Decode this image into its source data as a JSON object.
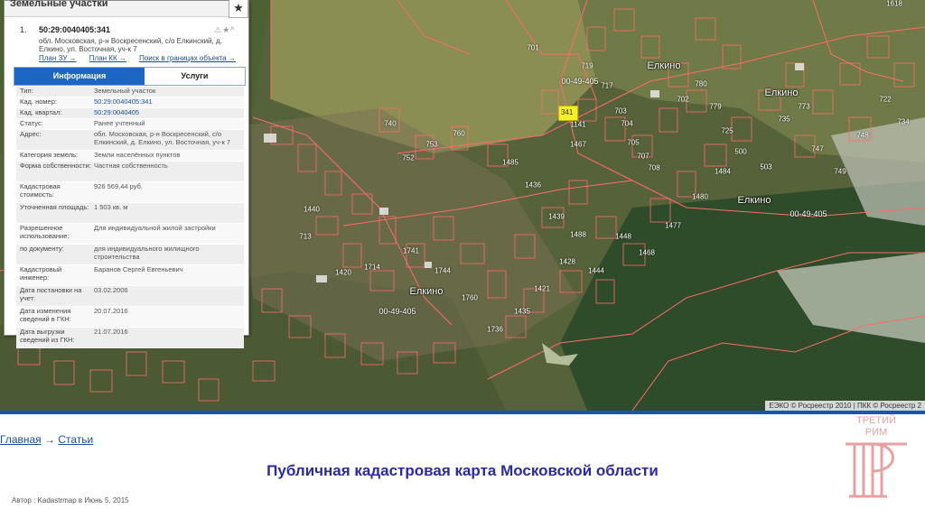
{
  "panel": {
    "title": "Земельные участки",
    "star_icon": "★",
    "result": {
      "index": "1.",
      "cad_number": "50:29:0040405:341",
      "address": "обл. Московская, р-н Воскресенский, с/о Елкинский, д. Елкино, ул. Восточная, уч-к 7",
      "icons": "⚠★^",
      "links": [
        "План ЗУ →",
        "План КК →",
        "Поиск в границах объекта →"
      ]
    },
    "tabs": [
      "Информация",
      "Услуги"
    ],
    "rows": [
      {
        "k": "Тип:",
        "v": "Земельный участок"
      },
      {
        "k": "Кад. номер:",
        "v": "50:29:0040405:341"
      },
      {
        "k": "Кад. квартал:",
        "v": "50:29:0040405"
      },
      {
        "k": "Статус:",
        "v": "Ранее учтенный"
      },
      {
        "k": "Адрес:",
        "v": "обл. Московская, р-н Воскресенский, с/о Елкинский, д. Елкино, ул. Восточная, уч-к 7"
      },
      {
        "k": "Категория земель:",
        "v": "Земли населённых пунктов"
      },
      {
        "k": "Форма собственности:",
        "v": "Частная собственность"
      },
      {
        "k": "Кадастровая стоимость:",
        "v": "926 569,44 руб."
      },
      {
        "k": "Уточненная площадь:",
        "v": "1 503 кв. м"
      },
      {
        "k": "Разрешенное использование:",
        "v": "Для индивидуальной жилой застройки"
      },
      {
        "k": "по документу:",
        "v": "для индивидуального жилищного строительства"
      },
      {
        "k": "Кадастровый инженер:",
        "v": "Баранов Сергей Евгеньевич"
      },
      {
        "k": "Дата постановки на учет:",
        "v": "03.02.2006"
      },
      {
        "k": "Дата изменения сведений в ГКН:",
        "v": "20.07.2016"
      },
      {
        "k": "Дата выгрузки сведений из ГКН:",
        "v": "21.07.2016"
      }
    ]
  },
  "map": {
    "villages": [
      "Елкино",
      "Елкино",
      "Елкино",
      "Елкино"
    ],
    "quarters": [
      "00-49-405",
      "00-49-405",
      "00-49-405"
    ],
    "highlight_parcel": "341",
    "parcel_numbers": [
      "701",
      "740",
      "753",
      "752",
      "760",
      "1141",
      "1467",
      "719",
      "717",
      "703",
      "704",
      "705",
      "707",
      "708",
      "1618",
      "702",
      "780",
      "779",
      "725",
      "500",
      "503",
      "735",
      "773",
      "747",
      "749",
      "748",
      "722",
      "734",
      "713",
      "1420",
      "1714",
      "1741",
      "1744",
      "1760",
      "1736",
      "1435",
      "1421",
      "1428",
      "1444",
      "1448",
      "1468",
      "1477",
      "1480",
      "1484",
      "1485",
      "1436",
      "1439",
      "1488",
      "1440"
    ],
    "attribution": "ЕЭКО © Росреестр 2010 | ПКК © Росреестр 2"
  },
  "breadcrumb": {
    "home": "Главная",
    "arrow": "→",
    "section": "Статьи"
  },
  "page_title": "Публичная кадастровая карта Московской области",
  "byline": "Автор : Kadastrmap в Июнь 5, 2015",
  "logo": {
    "line1": "ТРЕТИЙ",
    "line2": "РИМ",
    "letter": "Т"
  },
  "colors": {
    "parcel_border": "#ff6b6b",
    "panel_tab_active": "#1c67c4",
    "title": "#2c2aa0",
    "link": "#1750a0",
    "logo": "#e8a0a0"
  }
}
